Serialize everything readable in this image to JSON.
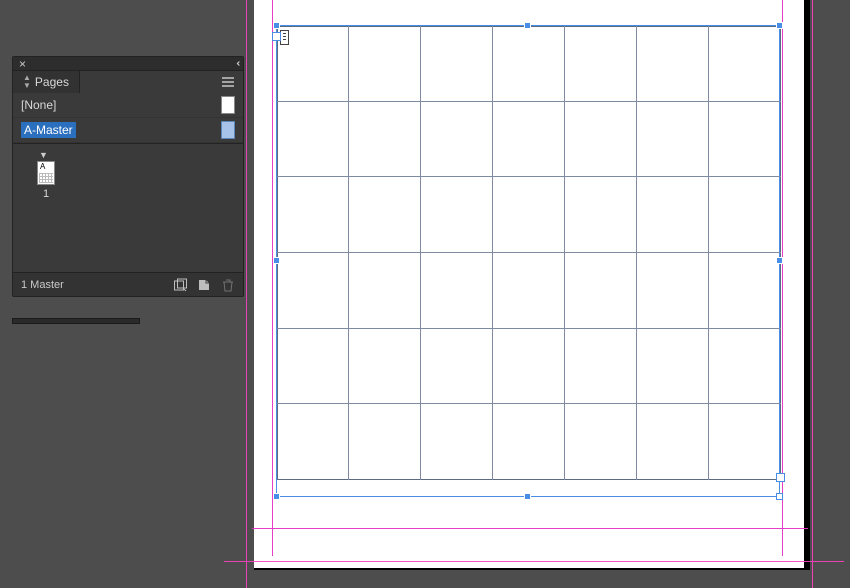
{
  "panel": {
    "title": "Pages",
    "masters": [
      {
        "label": "[None]",
        "selected": false
      },
      {
        "label": "A-Master",
        "selected": true
      }
    ],
    "pages": [
      {
        "number": "1",
        "master_letter": "A"
      }
    ],
    "footer_status": "1 Master"
  },
  "table": {
    "rows": 6,
    "cols": 7
  },
  "colors": {
    "selection": "#4a8de6",
    "bleed": "#ff3fbf",
    "margin": "#e535c4",
    "grid_line": "#7d8aa0"
  }
}
